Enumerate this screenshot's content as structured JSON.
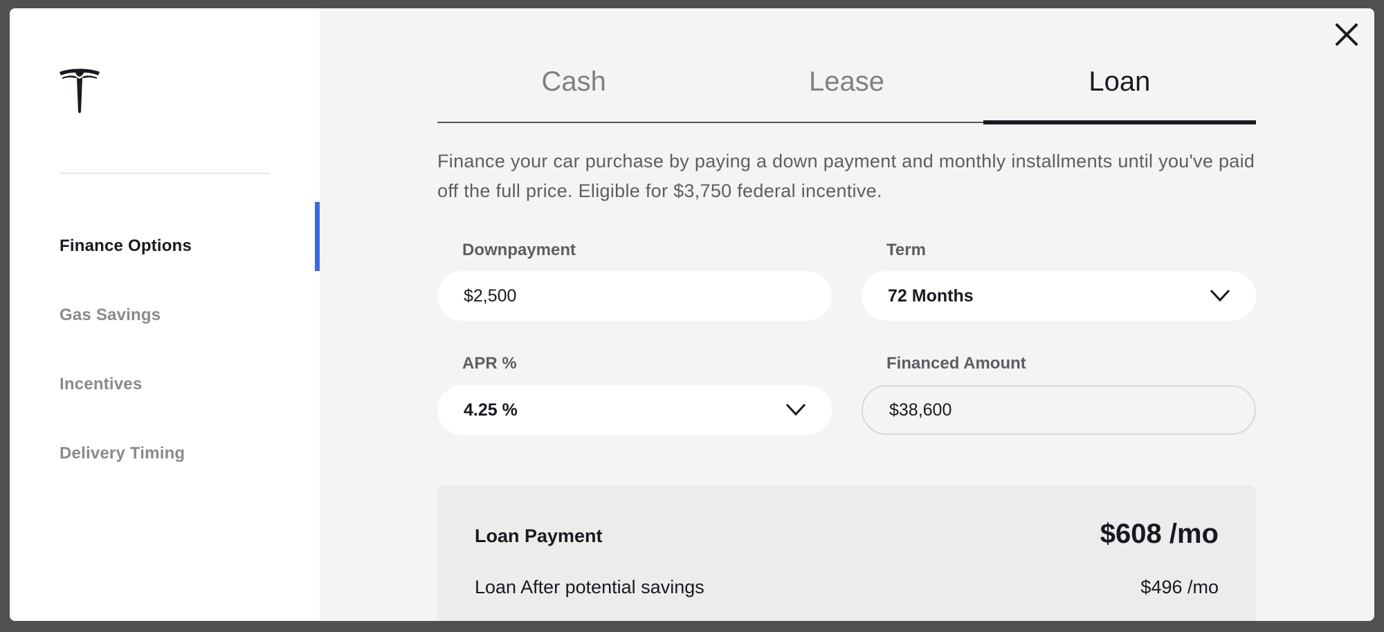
{
  "sidebar": {
    "logo": "tesla-logo",
    "items": [
      {
        "label": "Finance Options",
        "active": true
      },
      {
        "label": "Gas Savings",
        "active": false
      },
      {
        "label": "Incentives",
        "active": false
      },
      {
        "label": "Delivery Timing",
        "active": false
      }
    ]
  },
  "tabs": [
    {
      "label": "Cash",
      "active": false
    },
    {
      "label": "Lease",
      "active": false
    },
    {
      "label": "Loan",
      "active": true
    }
  ],
  "description": "Finance your car purchase by paying a down payment and monthly installments until you've paid off the full price. Eligible for $3,750 federal incentive.",
  "form": {
    "downpayment": {
      "label": "Downpayment",
      "value": "$2,500"
    },
    "term": {
      "label": "Term",
      "value": "72 Months"
    },
    "apr": {
      "label": "APR %",
      "value": "4.25 %"
    },
    "financed": {
      "label": "Financed Amount",
      "value": "$38,600"
    }
  },
  "summary": {
    "payment_label": "Loan Payment",
    "payment_value": "$608 /mo",
    "after_label": "Loan After potential savings",
    "after_value": "$496 /mo"
  },
  "colors": {
    "accent": "#3e6ae1",
    "text": "#171a20"
  }
}
